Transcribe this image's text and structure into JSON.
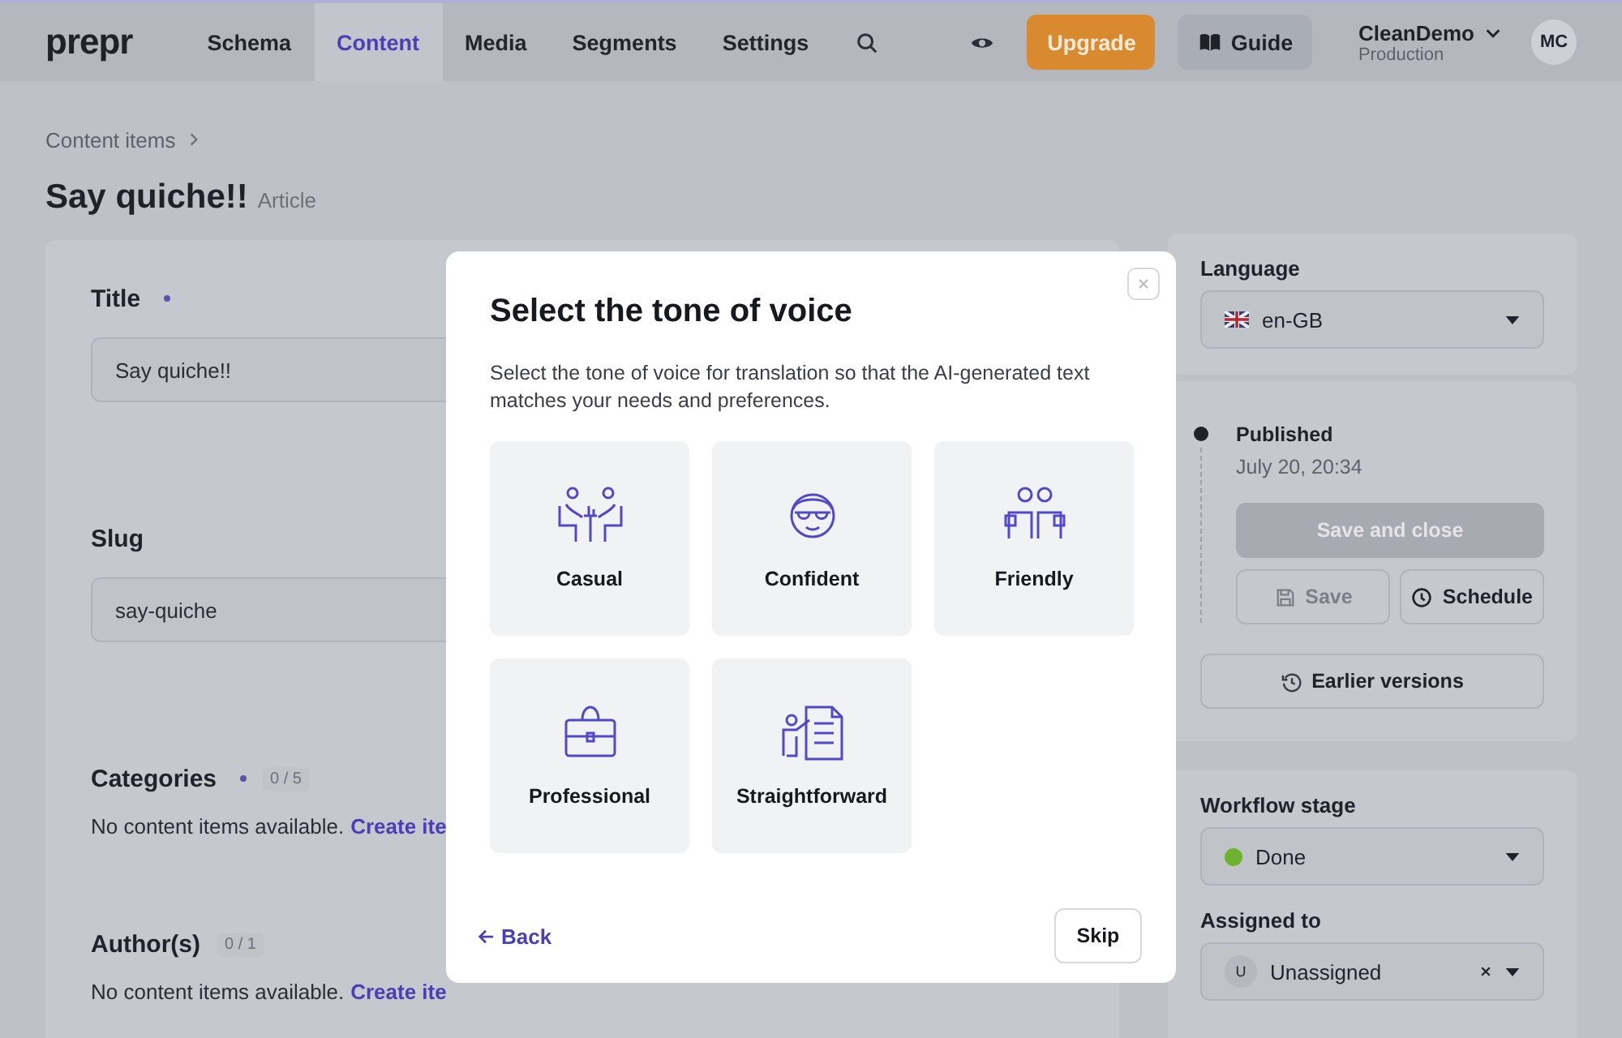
{
  "topbar": {
    "logo": "prepr",
    "nav": [
      {
        "label": "Schema",
        "selected": false
      },
      {
        "label": "Content",
        "selected": true
      },
      {
        "label": "Media",
        "selected": false
      },
      {
        "label": "Segments",
        "selected": false
      },
      {
        "label": "Settings",
        "selected": false
      }
    ],
    "upgrade": "Upgrade",
    "guide": "Guide",
    "account": {
      "name": "CleanDemo",
      "environment": "Production",
      "initials": "MC"
    }
  },
  "breadcrumb": "Content items",
  "page_title": "Say quiche!!",
  "page_type": "Article",
  "fields": [
    {
      "kind": "text",
      "label": "Title",
      "required": true,
      "value": "Say quiche!!"
    },
    {
      "kind": "text",
      "label": "Slug",
      "required": false,
      "value": "say-quiche"
    },
    {
      "kind": "reference",
      "label": "Categories",
      "required": true,
      "count": "0 / 5",
      "empty_text": "No content items available.",
      "link": "Create ite"
    },
    {
      "kind": "reference",
      "label": "Author(s)",
      "required": false,
      "count": "0 / 1",
      "empty_text": "No content items available.",
      "link": "Create ite"
    }
  ],
  "sidebar": {
    "language": {
      "label": "Language",
      "value": "en-GB"
    },
    "status": {
      "label": "Published",
      "date": "July 20, 20:34"
    },
    "save_and_close": {
      "label": "Save and close",
      "disabled": true
    },
    "save": {
      "label": "Save",
      "disabled": true
    },
    "schedule": {
      "label": "Schedule",
      "disabled": false
    },
    "earlier_versions": "Earlier versions",
    "workflow": {
      "label": "Workflow stage",
      "value": "Done",
      "color": "#6eb22e"
    },
    "assigned": {
      "label": "Assigned to",
      "initial": "U",
      "value": "Unassigned"
    }
  },
  "modal": {
    "title": "Select the tone of voice",
    "description": "Select the tone of voice for translation so that the AI-generated text matches your needs and preferences.",
    "options": [
      {
        "label": "Casual"
      },
      {
        "label": "Confident"
      },
      {
        "label": "Friendly"
      },
      {
        "label": "Professional"
      },
      {
        "label": "Straightforward"
      }
    ],
    "back": "Back",
    "skip": "Skip"
  }
}
